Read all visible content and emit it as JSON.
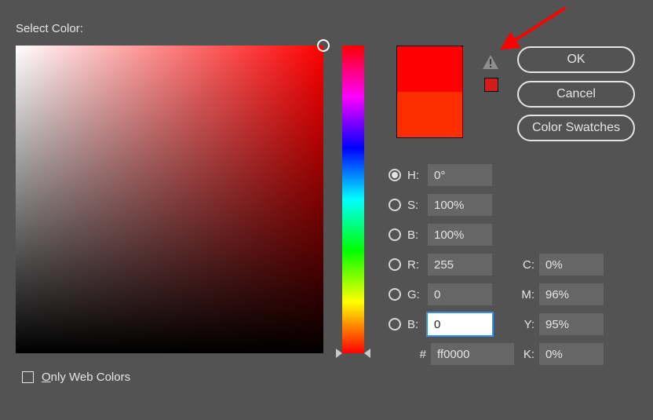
{
  "title": "Select Color:",
  "buttons": {
    "ok": "OK",
    "cancel": "Cancel",
    "swatches": "Color Swatches"
  },
  "preview": {
    "new": "#ff0000",
    "old": "#ff2e00",
    "warnSwatch": "#d11c1c"
  },
  "hsb": {
    "h_label": "H:",
    "h_value": "0°",
    "s_label": "S:",
    "s_value": "100%",
    "b_label": "B:",
    "b_value": "100%"
  },
  "rgb": {
    "r_label": "R:",
    "r_value": "255",
    "g_label": "G:",
    "g_value": "0",
    "b_label": "B:",
    "b_value": "0"
  },
  "hex": {
    "label": "#",
    "value": "ff0000"
  },
  "cmyk": {
    "c_label": "C:",
    "c_value": "0%",
    "m_label": "M:",
    "m_value": "96%",
    "y_label": "Y:",
    "y_value": "95%",
    "k_label": "K:",
    "k_value": "0%"
  },
  "onlyWeb": {
    "label_head": "O",
    "label_rest": "nly Web Colors"
  },
  "chart_data": {
    "type": "heatmap",
    "hue_deg": 0,
    "current_color": "#ff0000",
    "previous_color": "#ff2e00",
    "hsb": [
      0,
      100,
      100
    ],
    "rgb": [
      255,
      0,
      0
    ],
    "cmyk_percent": [
      0,
      96,
      95,
      0
    ]
  }
}
